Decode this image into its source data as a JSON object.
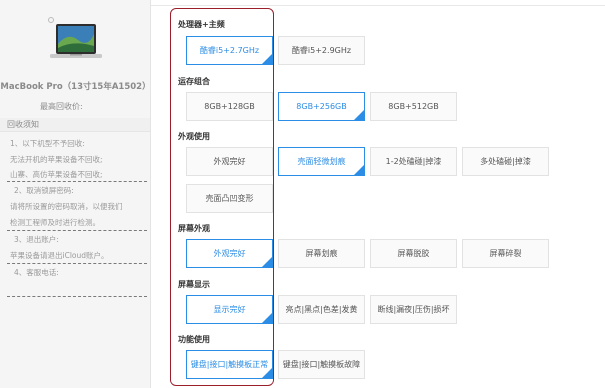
{
  "sidebar": {
    "model_name": "MacBook Pro（13寸15年A1502）",
    "price_label": "最高回收价:",
    "notice_title": "回收须知",
    "items": [
      {
        "heading": "1、以下机型不予回收:",
        "lines": [
          "无法开机的苹果设备不回收;",
          "山寨、高仿苹果设备不回收;"
        ]
      },
      {
        "heading": "2、取消锁屏密码:",
        "lines": [
          "请将所设置的密码取消，以便我们",
          "检测工程师及时进行检测。"
        ]
      },
      {
        "heading": "3、退出账户:",
        "lines": [
          "苹果设备请退出iCloud账户。"
        ]
      },
      {
        "heading": "4、客服电话:",
        "lines": []
      }
    ]
  },
  "options": {
    "categories": [
      {
        "label": "处理器+主频",
        "choices": [
          {
            "label": "酷睿i5+2.7GHz",
            "selected": true
          },
          {
            "label": "酷睿i5+2.9GHz",
            "selected": false
          }
        ]
      },
      {
        "label": "运存组合",
        "choices": [
          {
            "label": "8GB+128GB",
            "selected": false
          },
          {
            "label": "8GB+256GB",
            "selected": true
          },
          {
            "label": "8GB+512GB",
            "selected": false
          }
        ]
      },
      {
        "label": "外观使用",
        "choices": [
          {
            "label": "外观完好",
            "selected": false
          },
          {
            "label": "壳面轻微划痕",
            "selected": true
          },
          {
            "label": "1-2处磕碰|掉漆",
            "selected": false
          },
          {
            "label": "多处磕碰|掉漆",
            "selected": false
          },
          {
            "label": "壳面凸凹变形",
            "selected": false
          }
        ]
      },
      {
        "label": "屏幕外观",
        "choices": [
          {
            "label": "外观完好",
            "selected": true
          },
          {
            "label": "屏幕划痕",
            "selected": false
          },
          {
            "label": "屏幕脱胶",
            "selected": false
          },
          {
            "label": "屏幕碎裂",
            "selected": false
          }
        ]
      },
      {
        "label": "屏幕显示",
        "choices": [
          {
            "label": "显示完好",
            "selected": true
          },
          {
            "label": "亮点|黑点|色差|发黄",
            "selected": false
          },
          {
            "label": "断线|漏夜|压伤|损坏",
            "selected": false
          }
        ]
      },
      {
        "label": "功能使用",
        "choices": [
          {
            "label": "键盘|接口|触摸板正常",
            "selected": true
          },
          {
            "label": "键盘|接口|触摸板故障",
            "selected": false
          }
        ]
      }
    ]
  },
  "colors": {
    "accent": "#2b8de6",
    "highlight_border": "#9b1f2a"
  },
  "icons": {
    "selected_marker": "checkmark-corner-icon",
    "product": "laptop-thumbnail"
  }
}
